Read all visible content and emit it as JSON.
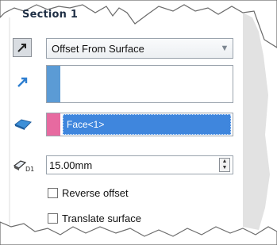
{
  "section": {
    "title": "Section 1"
  },
  "offset_type": {
    "value": "Offset From Surface",
    "arrow": "⯾"
  },
  "faces": {
    "items": [
      "Face<1>"
    ]
  },
  "distance": {
    "value": "15.00mm"
  },
  "options": {
    "reverse_offset": {
      "label": "Reverse offset",
      "checked": false
    },
    "translate_surface": {
      "label": "Translate surface",
      "checked": false
    }
  },
  "colors": {
    "accent_blue": "#5b9bd5",
    "accent_pink": "#e76aa0",
    "selection": "#3f86dd"
  },
  "icons": [
    "direction-toggle-icon",
    "direction-arrow-icon",
    "face-select-icon",
    "distance-icon",
    "chevron-down-icon",
    "spin-up-icon",
    "spin-down-icon"
  ]
}
